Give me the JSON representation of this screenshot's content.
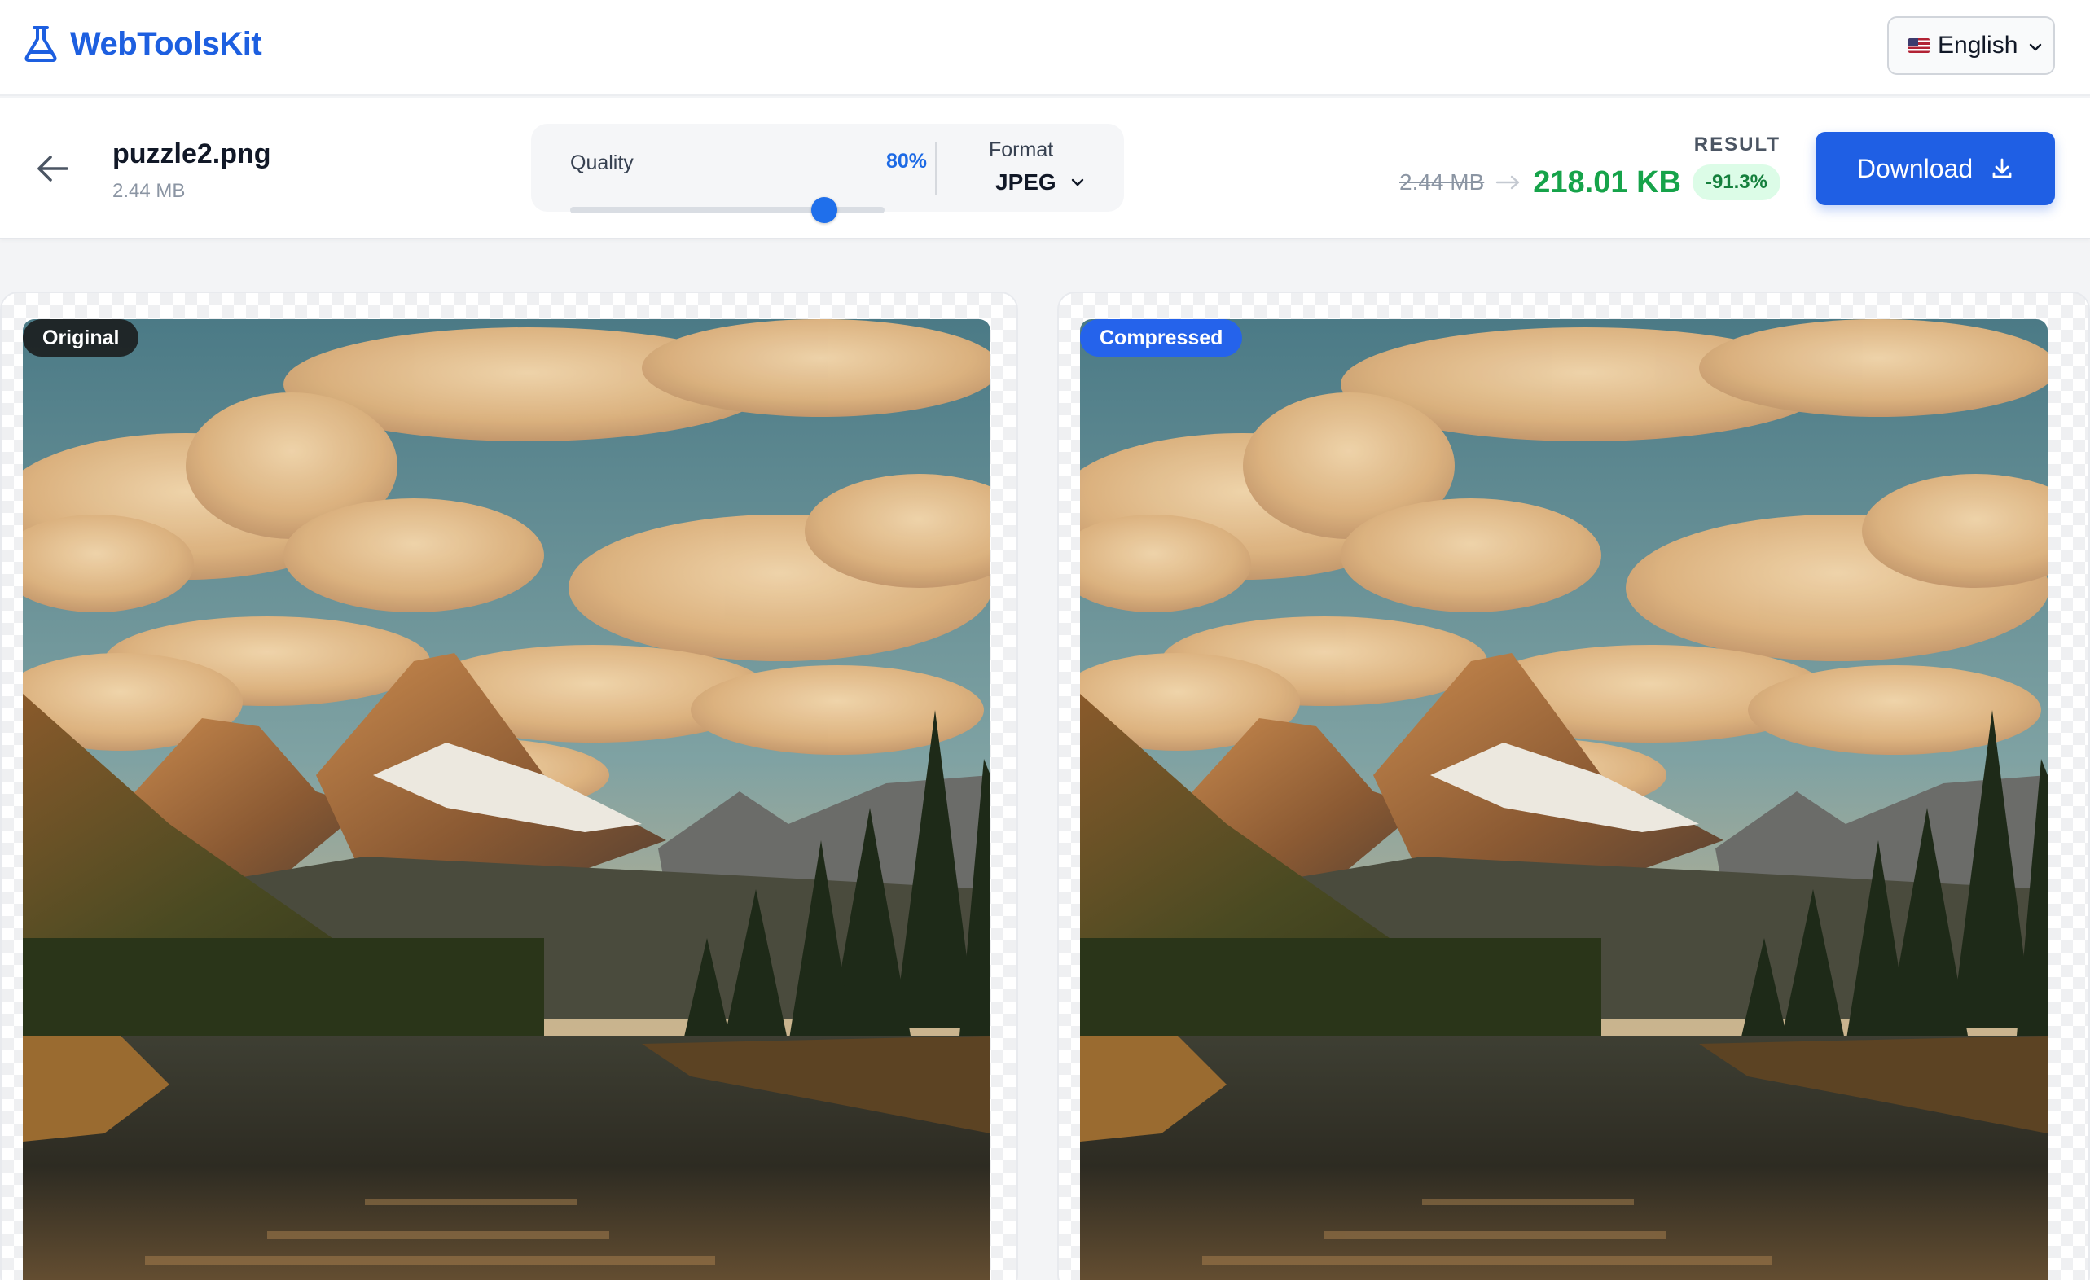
{
  "brand": {
    "name": "WebToolsKit",
    "logo_icon": "flask-icon",
    "color": "#1d5fe0"
  },
  "language": {
    "flag_icon": "us-flag-icon",
    "label": "English"
  },
  "file": {
    "name": "puzzle2.png",
    "size": "2.44 MB"
  },
  "quality": {
    "label": "Quality",
    "value_text": "80%",
    "value": 0.8
  },
  "format": {
    "label": "Format",
    "value": "JPEG"
  },
  "result": {
    "label": "RESULT",
    "original_size": "2.44 MB",
    "new_size": "218.01 KB",
    "reduction": "-91.3%",
    "accent": "#16a34a"
  },
  "download": {
    "label": "Download",
    "icon": "download-icon",
    "color": "#1f5fe4"
  },
  "panels": {
    "original": {
      "badge": "Original"
    },
    "compressed": {
      "badge": "Compressed"
    }
  }
}
